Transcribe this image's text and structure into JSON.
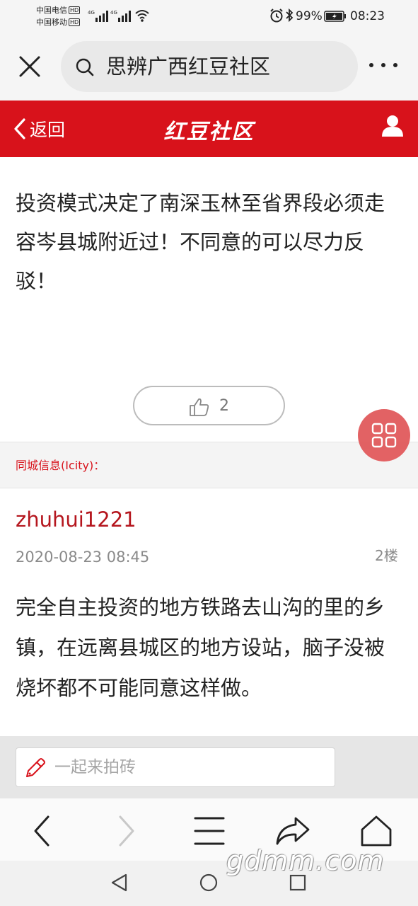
{
  "status_bar": {
    "carrier_1": "中国电信",
    "carrier_2": "中国移动",
    "hd_badge": "HD",
    "network": "4G",
    "battery": "99%",
    "time": "08:23",
    "icons": [
      "alarm-icon",
      "bluetooth-icon",
      "wifi-icon",
      "battery-icon"
    ]
  },
  "browser": {
    "search_text": "思辨广西红豆社区",
    "icons": [
      "close-icon",
      "search-icon",
      "more-icon"
    ]
  },
  "header": {
    "back_label": "返回",
    "brand": "红豆社区",
    "accent_color": "#d8121b"
  },
  "post": {
    "body": "投资模式决定了南深玉林至省界段必须走容岑县城附近过！不同意的可以尽力反驳！",
    "like_count": "2"
  },
  "section": {
    "title": "同城信息(Icity)："
  },
  "reply": {
    "author": "zhuhui1221",
    "timestamp": "2020-08-23 08:45",
    "floor": "2楼",
    "body": "完全自主投资的地方铁路去山沟的里的乡镇，在远离县城区的地方设站，脑子没被烧坏都不可能同意这样做。"
  },
  "comment": {
    "placeholder": "一起来拍砖"
  },
  "watermark": "gdmm.com"
}
